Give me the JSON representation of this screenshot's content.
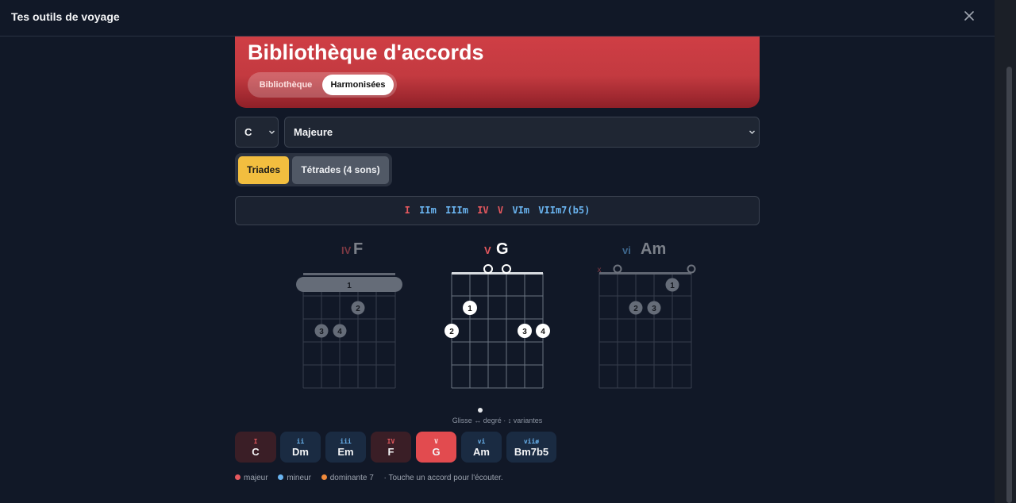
{
  "window": {
    "title": "Tes outils de voyage",
    "close_icon": "close-icon"
  },
  "hero": {
    "title": "Bibliothèque d'accords",
    "tabs": [
      "Bibliothèque",
      "Harmonisées"
    ],
    "active_tab": "Harmonisées"
  },
  "controls": {
    "key_value": "C",
    "scale_value": "Majeure"
  },
  "chord_type": {
    "options": [
      "Triades",
      "Tétrades (4 sons)"
    ],
    "active": "Triades"
  },
  "progression": [
    {
      "label": "I",
      "quality": "major"
    },
    {
      "label": "IIm",
      "quality": "minor"
    },
    {
      "label": "IIIm",
      "quality": "minor"
    },
    {
      "label": "IV",
      "quality": "major"
    },
    {
      "label": "V",
      "quality": "major"
    },
    {
      "label": "VIm",
      "quality": "minor"
    },
    {
      "label": "VIIm7(b5)",
      "quality": "minor"
    }
  ],
  "carousel": {
    "prev": {
      "degree": "IV",
      "name": "F",
      "barre_label": "1",
      "fingers": [
        "2",
        "3",
        "4"
      ]
    },
    "current": {
      "degree": "V",
      "name": "G",
      "fingers": [
        "1",
        "2",
        "3",
        "4"
      ],
      "open_strings": 2
    },
    "next": {
      "degree": "vi",
      "name": "Am",
      "muted": "x",
      "fingers": [
        "1",
        "2",
        "3"
      ],
      "open_strings": 2
    },
    "hint": "Glisse ↔ degré · ↕ variantes"
  },
  "chips": [
    {
      "degree": "I",
      "name": "C",
      "quality": "major"
    },
    {
      "degree": "ii",
      "name": "Dm",
      "quality": "minor"
    },
    {
      "degree": "iii",
      "name": "Em",
      "quality": "minor"
    },
    {
      "degree": "IV",
      "name": "F",
      "quality": "major"
    },
    {
      "degree": "V",
      "name": "G",
      "quality": "major",
      "active": true
    },
    {
      "degree": "vi",
      "name": "Am",
      "quality": "minor"
    },
    {
      "degree": "viiø",
      "name": "Bm7b5",
      "quality": "minor"
    }
  ],
  "legend": {
    "major": "majeur",
    "minor": "mineur",
    "dom7": "dominante 7",
    "note": "· Touche un accord pour l'écouter."
  },
  "colors": {
    "major": "#e5585e",
    "minor": "#6ab4f0",
    "dom7": "#f08a3c",
    "active": "#e24b4f",
    "accent": "#f2be3f"
  }
}
